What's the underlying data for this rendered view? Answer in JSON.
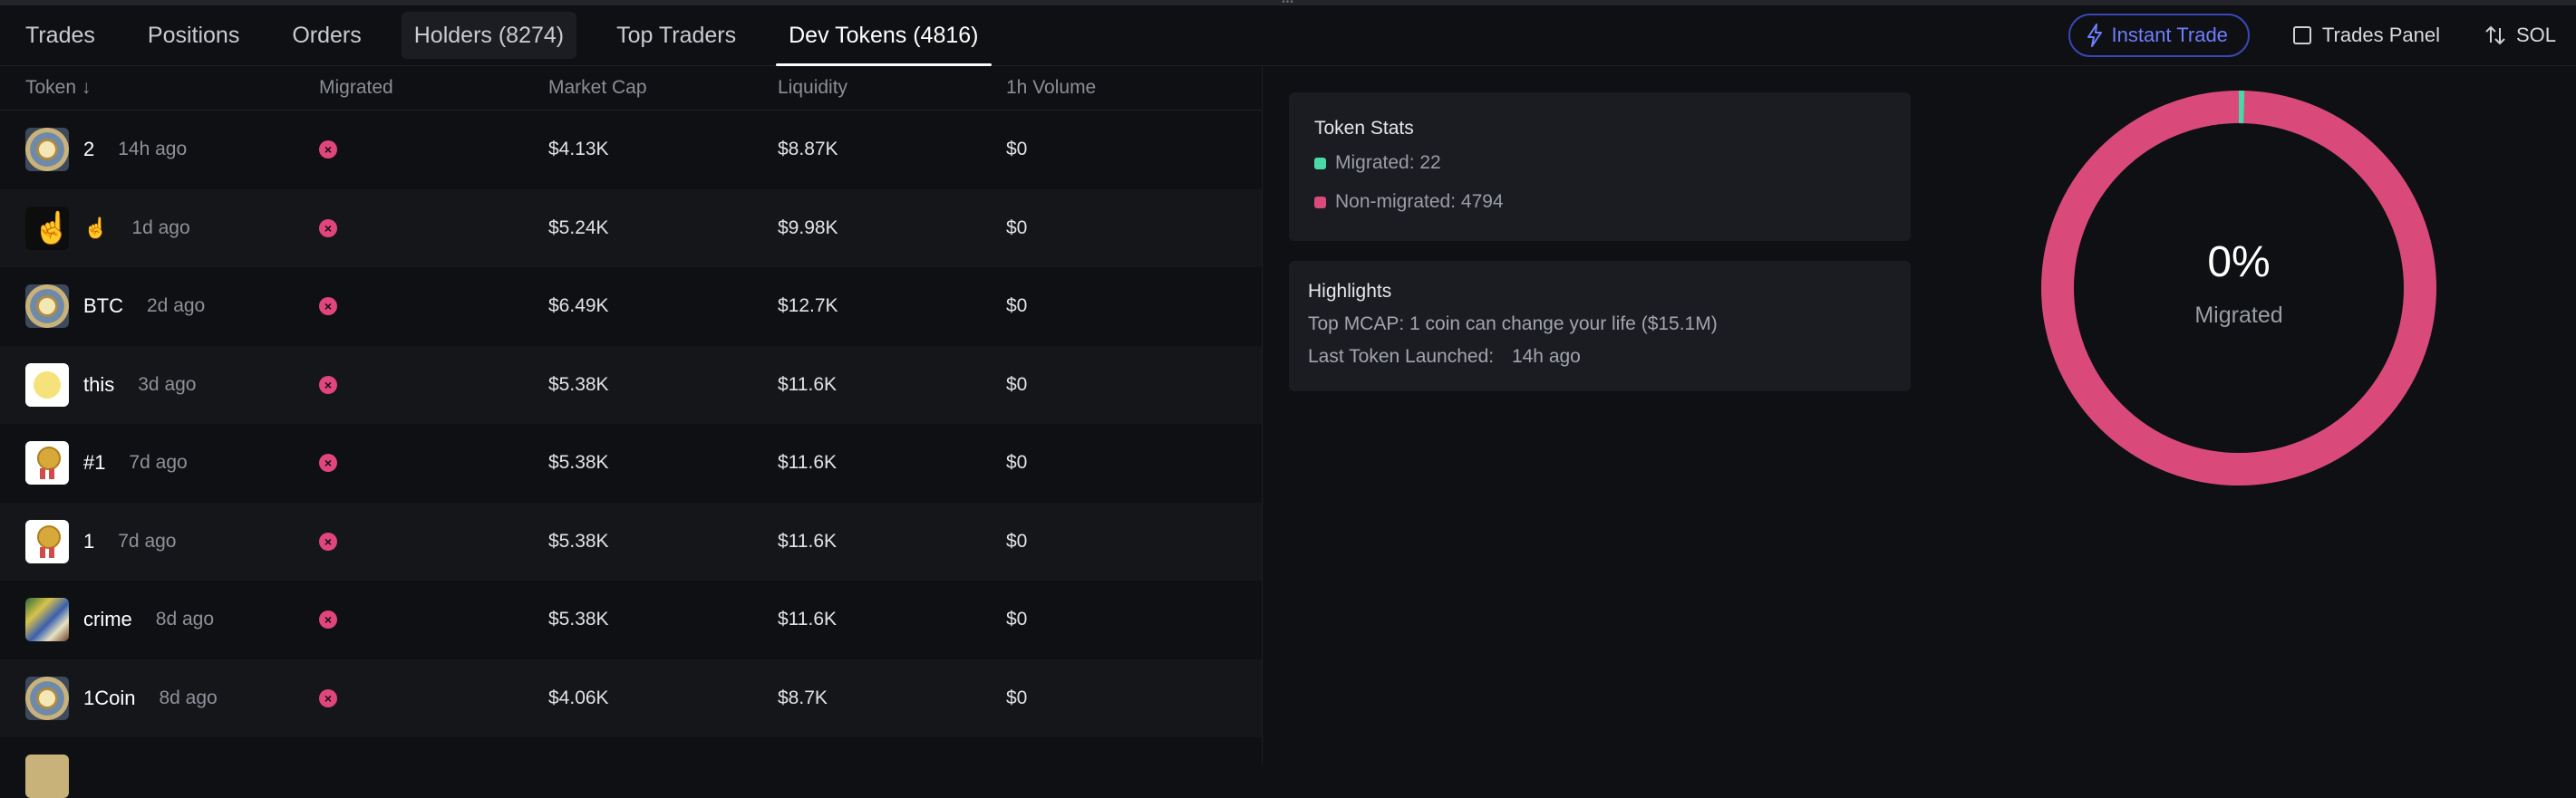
{
  "tabs": [
    {
      "label": "Trades"
    },
    {
      "label": "Positions"
    },
    {
      "label": "Orders"
    },
    {
      "label": "Holders (8274)"
    },
    {
      "label": "Top Traders"
    },
    {
      "label": "Dev Tokens (4816)"
    }
  ],
  "toolbar": {
    "instant_trade_label": "Instant Trade",
    "trades_panel_label": "Trades Panel",
    "currency_label": "SOL"
  },
  "table": {
    "columns": [
      "Token ↓",
      "Migrated",
      "Market Cap",
      "Liquidity",
      "1h Volume"
    ],
    "rows": [
      {
        "name": "2",
        "age": "14h ago",
        "market_cap": "$4.13K",
        "liquidity": "$8.87K",
        "volume_1h": "$0",
        "avatar": "coin-avatar"
      },
      {
        "name": "☝️",
        "age": "1d ago",
        "market_cap": "$5.24K",
        "liquidity": "$9.98K",
        "volume_1h": "$0",
        "avatar": "finger-avatar"
      },
      {
        "name": "BTC",
        "age": "2d ago",
        "market_cap": "$6.49K",
        "liquidity": "$12.7K",
        "volume_1h": "$0",
        "avatar": "coin-avatar"
      },
      {
        "name": "this",
        "age": "3d ago",
        "market_cap": "$5.38K",
        "liquidity": "$11.6K",
        "volume_1h": "$0",
        "avatar": "this-avatar"
      },
      {
        "name": "#1",
        "age": "7d ago",
        "market_cap": "$5.38K",
        "liquidity": "$11.6K",
        "volume_1h": "$0",
        "avatar": "medal-avatar"
      },
      {
        "name": "1",
        "age": "7d ago",
        "market_cap": "$5.38K",
        "liquidity": "$11.6K",
        "volume_1h": "$0",
        "avatar": "medal-avatar"
      },
      {
        "name": "crime",
        "age": "8d ago",
        "market_cap": "$5.38K",
        "liquidity": "$11.6K",
        "volume_1h": "$0",
        "avatar": "crime-avatar"
      },
      {
        "name": "1Coin",
        "age": "8d ago",
        "market_cap": "$4.06K",
        "liquidity": "$8.7K",
        "volume_1h": "$0",
        "avatar": "coin-avatar"
      }
    ]
  },
  "token_stats": {
    "title": "Token Stats",
    "migrated_label": "Migrated: 22",
    "non_migrated_label": "Non-migrated: 4794",
    "migrated_color": "#4ad8a7",
    "non_migrated_color": "#d94a7b"
  },
  "highlights": {
    "title": "Highlights",
    "top_mcap": "Top MCAP: 1 coin can change your life ($15.1M)",
    "last_launched_label": "Last Token Launched:",
    "last_launched_value": "14h ago"
  },
  "donut": {
    "percent_label": "0%",
    "caption": "Migrated",
    "migrated": 22,
    "non_migrated": 4794
  },
  "colors": {
    "accent": "#6f7dff",
    "pink": "#d94a7b",
    "green": "#4ad8a7"
  }
}
